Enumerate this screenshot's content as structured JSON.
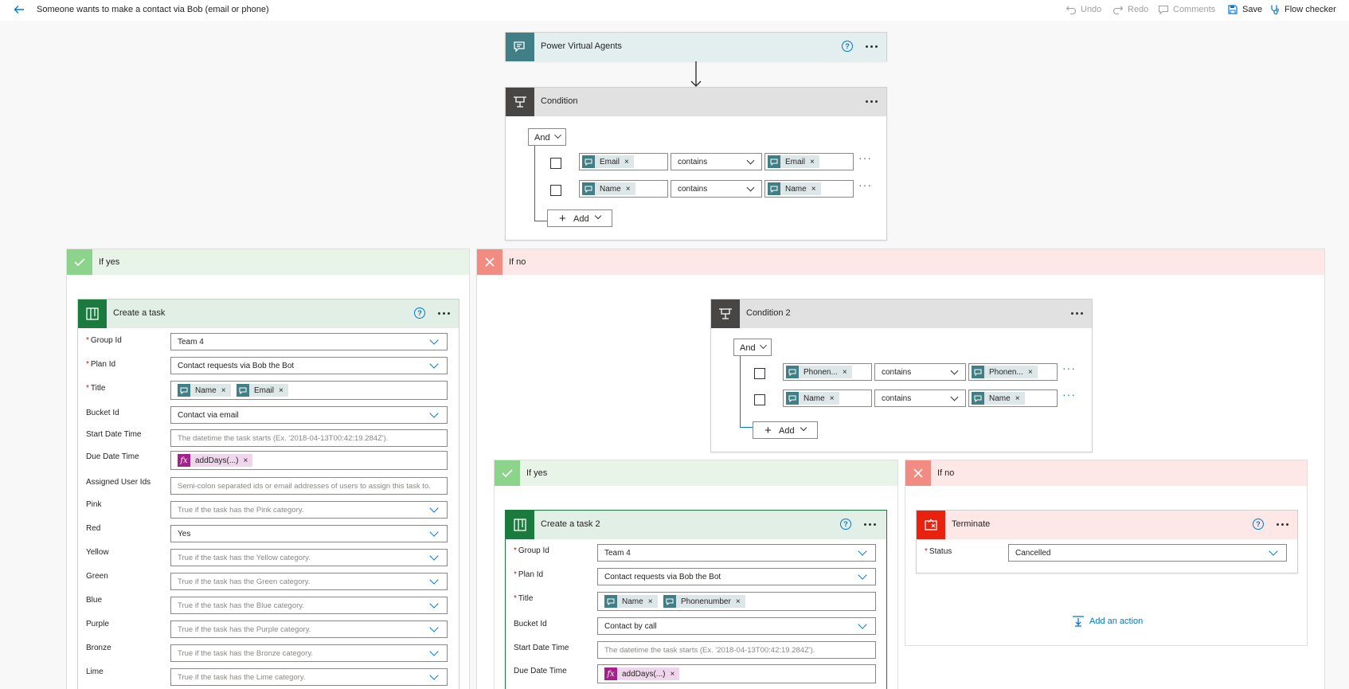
{
  "header": {
    "flow_title": "Someone wants to make a contact via Bob (email or phone)",
    "undo": "Undo",
    "redo": "Redo",
    "comments": "Comments",
    "save": "Save",
    "flow_checker": "Flow checker"
  },
  "trigger": {
    "title": "Power Virtual Agents",
    "help": "?",
    "color": "#3f7f85"
  },
  "condition1": {
    "title": "Condition",
    "and_label": "And",
    "rows": [
      {
        "left": "Email",
        "operator": "contains",
        "right": "Email"
      },
      {
        "left": "Name",
        "operator": "contains",
        "right": "Name"
      }
    ],
    "add_label": "Add"
  },
  "if_yes": {
    "label": "If yes",
    "task": {
      "title": "Create a task",
      "help": "?",
      "fields": {
        "group_id_label": "Group Id",
        "group_id_value": "Team 4",
        "plan_id_label": "Plan Id",
        "plan_id_value": "Contact requests via Bob the Bot",
        "title_label": "Title",
        "title_token1": "Name",
        "title_token2": "Email",
        "bucket_label": "Bucket Id",
        "bucket_value": "Contact via email",
        "start_label": "Start Date Time",
        "start_placeholder": "The datetime the task starts (Ex. '2018-04-13T00:42:19.284Z').",
        "due_label": "Due Date Time",
        "due_token": "addDays(...)",
        "assigned_label": "Assigned User Ids",
        "assigned_placeholder": "Semi-colon separated ids or email addresses of users to assign this task to.",
        "pink_label": "Pink",
        "pink_placeholder": "True if the task has the Pink category.",
        "red_label": "Red",
        "red_value": "Yes",
        "yellow_label": "Yellow",
        "yellow_placeholder": "True if the task has the Yellow category.",
        "green_label": "Green",
        "green_placeholder": "True if the task has the Green category.",
        "blue_label": "Blue",
        "blue_placeholder": "True if the task has the Blue category.",
        "purple_label": "Purple",
        "purple_placeholder": "True if the task has the Purple category.",
        "bronze_label": "Bronze",
        "bronze_placeholder": "True if the task has the Bronze category.",
        "lime_label": "Lime",
        "lime_placeholder": "True if the task has the Lime category."
      }
    }
  },
  "if_no": {
    "label": "If no",
    "condition2": {
      "title": "Condition 2",
      "and_label": "And",
      "rows": [
        {
          "left": "Phonen...",
          "operator": "contains",
          "right": "Phonen..."
        },
        {
          "left": "Name",
          "operator": "contains",
          "right": "Name"
        }
      ],
      "add_label": "Add"
    },
    "inner_yes": {
      "label": "If yes",
      "task": {
        "title": "Create a task 2",
        "help": "?",
        "group_id_label": "Group Id",
        "group_id_value": "Team 4",
        "plan_id_label": "Plan Id",
        "plan_id_value": "Contact requests via Bob the Bot",
        "title_label": "Title",
        "title_token1": "Name",
        "title_token2": "Phonenumber",
        "bucket_label": "Bucket Id",
        "bucket_value": "Contact by call",
        "start_label": "Start Date Time",
        "start_placeholder": "The datetime the task starts (Ex. '2018-04-13T00:42:19.284Z').",
        "due_label": "Due Date Time",
        "due_token": "addDays(...)"
      }
    },
    "inner_no": {
      "label": "If no",
      "terminate": {
        "title": "Terminate",
        "help": "?",
        "status_label": "Status",
        "status_value": "Cancelled"
      },
      "add_action": "Add an action"
    }
  },
  "colors": {
    "accent": "#0078d4",
    "yes_bg": "#e9f4e9",
    "yes_icon": "#8cd48c",
    "no_bg": "#fde7e7",
    "no_icon": "#f28b82",
    "planner": "#1b7a3e",
    "condition_head": "#e1e1e1",
    "condition_icon": "#484644",
    "terminate": "#e8220f"
  }
}
